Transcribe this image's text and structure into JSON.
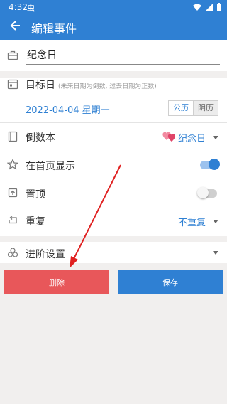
{
  "status": {
    "time": "4:32",
    "app_glyph": "虫"
  },
  "appbar": {
    "title": "编辑事件"
  },
  "name_field": {
    "value": "纪念日"
  },
  "target_date": {
    "label": "目标日",
    "hint": "(未来日期为倒数, 过去日期为正数)",
    "date": "2022-04-04 星期一",
    "solar": "公历",
    "lunar": "阴历"
  },
  "countdown_book": {
    "label": "倒数本",
    "value": "纪念日"
  },
  "show_home": {
    "label": "在首页显示",
    "on": true
  },
  "pin_top": {
    "label": "置顶",
    "on": false
  },
  "repeat": {
    "label": "重复",
    "value": "不重复"
  },
  "advanced": {
    "label": "进阶设置"
  },
  "buttons": {
    "delete": "删除",
    "save": "保存"
  },
  "colors": {
    "primary": "#2f80d3",
    "danger": "#e8575a",
    "annotation": "#e02020"
  }
}
